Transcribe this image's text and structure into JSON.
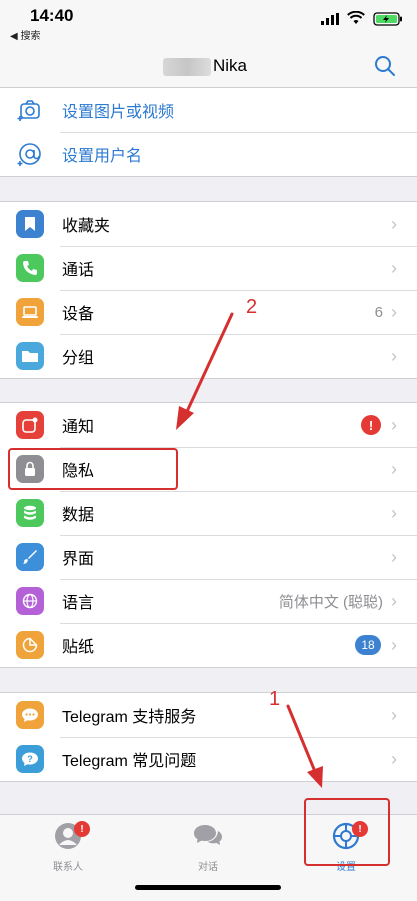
{
  "status": {
    "time": "14:40",
    "back": "◀ 搜索"
  },
  "header": {
    "name": "Nika"
  },
  "profile": [
    {
      "label": "设置图片或视频",
      "icon": "camera-add-icon"
    },
    {
      "label": "设置用户名",
      "icon": "at-sign-icon"
    }
  ],
  "group1": [
    {
      "label": "收藏夹",
      "icon": "bookmark-icon",
      "color": "#3c82d0"
    },
    {
      "label": "通话",
      "icon": "phone-icon",
      "color": "#4cc85c"
    },
    {
      "label": "设备",
      "icon": "laptop-icon",
      "color": "#f0a33a",
      "value": "6"
    },
    {
      "label": "分组",
      "icon": "folder-icon",
      "color": "#4aa8dc"
    }
  ],
  "group2": [
    {
      "label": "通知",
      "icon": "notification-icon",
      "color": "#e5403a",
      "alert": "!"
    },
    {
      "label": "隐私",
      "icon": "lock-icon",
      "color": "#8e8e93"
    },
    {
      "label": "数据",
      "icon": "database-icon",
      "color": "#4cc85c"
    },
    {
      "label": "界面",
      "icon": "brush-icon",
      "color": "#3c8fd8"
    },
    {
      "label": "语言",
      "icon": "globe-icon",
      "color": "#b460d6",
      "value": "简体中文 (聪聪)"
    },
    {
      "label": "贴纸",
      "icon": "sticker-icon",
      "color": "#f0a33a",
      "badge": "18"
    }
  ],
  "group3": [
    {
      "label": "Telegram 支持服务",
      "icon": "chat-bubble-icon",
      "color": "#f0a33a"
    },
    {
      "label": "Telegram 常见问题",
      "icon": "question-icon",
      "color": "#3c9ed8"
    }
  ],
  "tabs": [
    {
      "label": "联系人",
      "badge": "!",
      "icon": "contacts-icon"
    },
    {
      "label": "对话",
      "icon": "chats-icon"
    },
    {
      "label": "设置",
      "badge": "!",
      "icon": "settings-icon"
    }
  ],
  "annotations": {
    "one": "1",
    "two": "2"
  },
  "colors": {
    "accent": "#2c7bd0",
    "annotation": "#d62f2f"
  }
}
